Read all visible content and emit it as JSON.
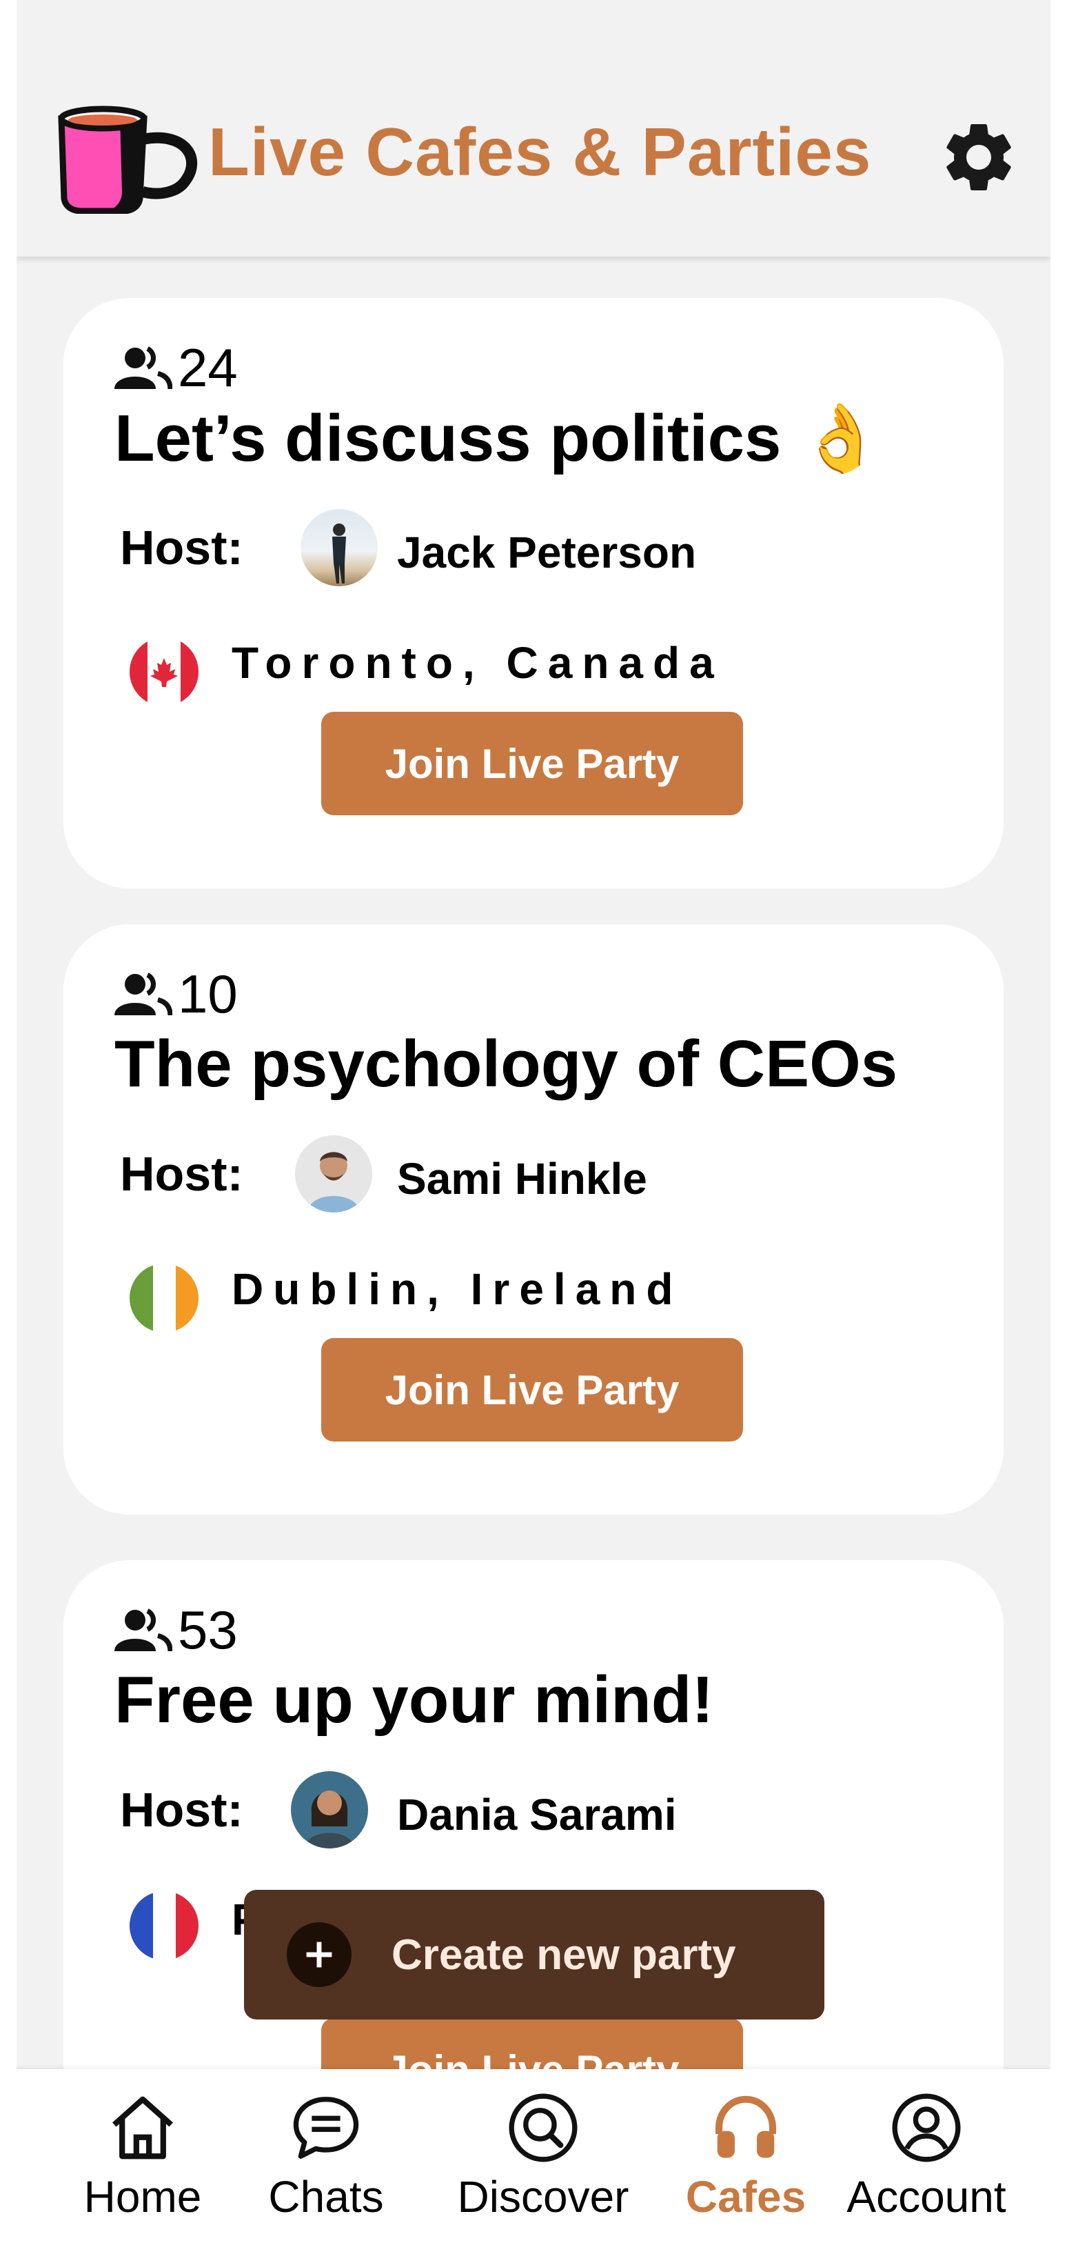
{
  "header": {
    "title": "Live Cafes & Parties",
    "logo_icon": "coffee-mug-icon",
    "settings_icon": "gear-icon"
  },
  "parties": [
    {
      "participants": "24",
      "title": "Let’s discuss politics 👌",
      "host_label": "Host:",
      "host_name": "Jack Peterson",
      "location": "Toronto, Canada",
      "flag": "canada-flag-icon",
      "join_label": "Join Live Party"
    },
    {
      "participants": "10",
      "title": "The psychology of CEOs",
      "host_label": "Host:",
      "host_name": "Sami Hinkle",
      "location": "Dublin, Ireland",
      "flag": "ireland-flag-icon",
      "join_label": "Join Live Party"
    },
    {
      "participants": "53",
      "title": "Free up your mind!",
      "host_label": "Host:",
      "host_name": "Dania Sarami",
      "location": "P",
      "flag": "france-flag-icon",
      "join_label": "Join Live Party"
    }
  ],
  "fab": {
    "label": "Create new party",
    "icon": "plus-icon"
  },
  "nav": {
    "items": [
      {
        "label": "Home",
        "icon": "home-icon"
      },
      {
        "label": "Chats",
        "icon": "chat-bubble-icon"
      },
      {
        "label": "Discover",
        "icon": "search-icon"
      },
      {
        "label": "Cafes",
        "icon": "headphones-icon",
        "active": true
      },
      {
        "label": "Account",
        "icon": "account-icon"
      }
    ]
  },
  "colors": {
    "accent": "#c87941",
    "fab_background": "#523220",
    "background": "#f2f2f2"
  }
}
